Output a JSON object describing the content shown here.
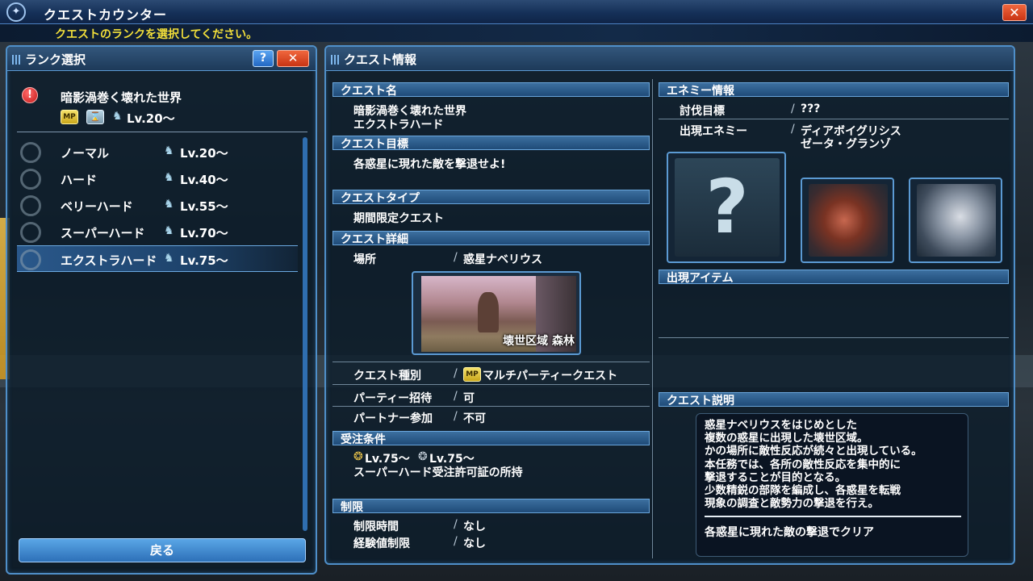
{
  "window": {
    "title": "クエストカウンター",
    "instruction": "クエストのランクを選択してください。",
    "close_label": "✕"
  },
  "rank_panel": {
    "title": "ランク選択",
    "help_label": "?",
    "close_label": "✕",
    "quest_summary": {
      "name": "暗影渦巻く壊れた世界",
      "level": "Lv.20〜"
    },
    "ranks": [
      {
        "label": "ノーマル",
        "level": "Lv.20〜"
      },
      {
        "label": "ハード",
        "level": "Lv.40〜"
      },
      {
        "label": "ベリーハード",
        "level": "Lv.55〜"
      },
      {
        "label": "スーパーハード",
        "level": "Lv.70〜"
      },
      {
        "label": "エクストラハード",
        "level": "Lv.75〜"
      }
    ],
    "selected_rank": "エクストラハード",
    "back_label": "戻る"
  },
  "info_panel": {
    "title": "クエスト情報",
    "quest_name_header": "クエスト名",
    "quest_name_line1": "暗影渦巻く壊れた世界",
    "quest_name_line2": "エクストラハード",
    "objective_header": "クエスト目標",
    "objective": "各惑星に現れた敵を撃退せよ!",
    "type_header": "クエストタイプ",
    "type": "期間限定クエスト",
    "detail_header": "クエスト詳細",
    "location_label": "場所",
    "location_value": "惑星ナベリウス",
    "location_image_caption": "壊世区域 森林",
    "category_label": "クエスト種別",
    "category_value": "マルチパーティークエスト",
    "party_invite_label": "パーティー招待",
    "party_invite_value": "可",
    "partner_label": "パートナー参加",
    "partner_value": "不可",
    "conditions_header": "受注条件",
    "condition_levels": "Lv.75〜 ",
    "condition_levels_sub": "Lv.75〜",
    "condition_permit": "スーパーハード受注許可証の所持",
    "restrictions_header": "制限",
    "time_limit_label": "制限時間",
    "time_limit_value": "なし",
    "exp_limit_label": "経験値制限",
    "exp_limit_value": "なし"
  },
  "enemy_info": {
    "header": "エネミー情報",
    "target_label": "討伐目標",
    "target_value": "???",
    "appear_label": "出現エネミー",
    "appear_line1": "ディアボイグリシス",
    "appear_line2": "ゼータ・グランゾ",
    "unknown_mark": "?"
  },
  "items": {
    "header": "出現アイテム"
  },
  "description": {
    "header": "クエスト説明",
    "body": "惑星ナベリウスをはじめとした\n複数の惑星に出現した壊世区域。\nかの場所に敵性反応が続々と出現している。\n本任務では、各所の敵性反応を集中的に\n撃退することが目的となる。\n少数精鋭の部隊を編成し、各惑星を転戦\n現象の調査と敵勢力の撃退を行え。",
    "clear_condition": "各惑星に現れた敵の撃退でクリア"
  },
  "colors": {
    "accent": "#4f8fc9",
    "instruction_text": "#f2df3a",
    "close_button": "#d9441f",
    "selected_row": "#2d5f96"
  },
  "icons": [
    "alert-icon",
    "multi-party-icon",
    "hourglass-icon",
    "level-icon",
    "help-icon",
    "close-icon",
    "scroll-arrow-icon"
  ]
}
